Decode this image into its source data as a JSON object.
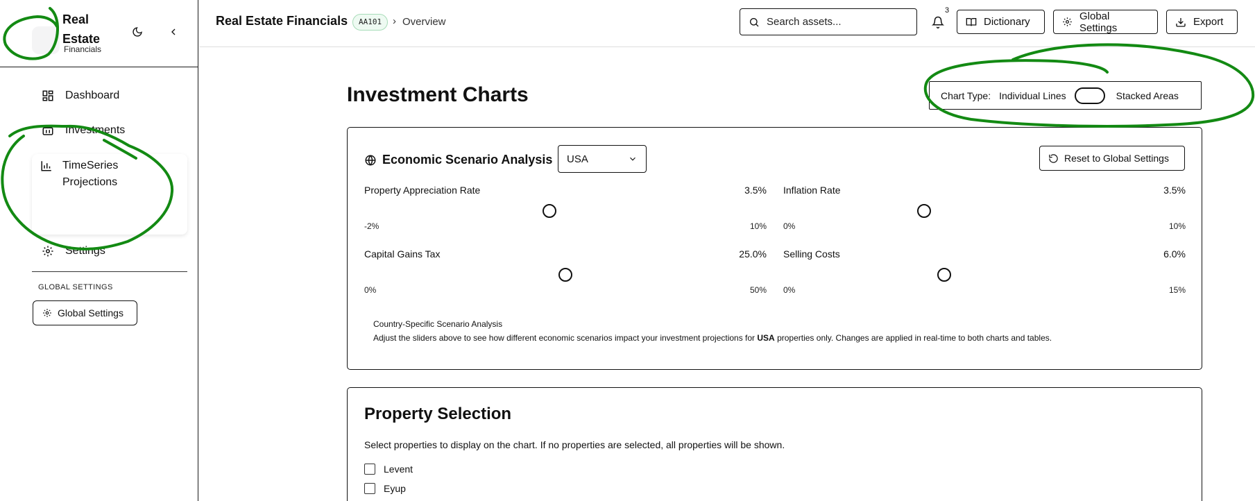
{
  "colors": {
    "accent": "#111111",
    "badge_bg": "#eefaf2",
    "badge_border": "#a7dcb8",
    "annotation": "#138a13"
  },
  "sidebar": {
    "brand": {
      "title": "Real Estate",
      "subtitle": "Financials"
    },
    "items": [
      {
        "label": "Dashboard",
        "icon": "dashboard-icon"
      },
      {
        "label": "Investments",
        "icon": "briefcase-icon"
      },
      {
        "label": "TimeSeries Projections",
        "icon": "bar-chart-icon"
      },
      {
        "label": "Settings",
        "icon": "gear-icon"
      }
    ],
    "section_label": "GLOBAL SETTINGS",
    "global_settings_button": "Global Settings"
  },
  "header": {
    "title": "Real Estate Financials",
    "code": "AA101",
    "breadcrumb_sep": "›",
    "breadcrumb": "Overview",
    "search_placeholder": "Search assets...",
    "notification_count": "3",
    "buttons": {
      "dictionary": "Dictionary",
      "global_settings": "Global Settings",
      "export": "Export"
    }
  },
  "main": {
    "title": "Investment Charts",
    "chart_type": {
      "label": "Chart Type:",
      "option_left": "Individual Lines",
      "option_right": "Stacked Areas",
      "stacked": false
    },
    "scenario": {
      "title": "Economic Scenario Analysis",
      "country": "USA",
      "reset_label": "Reset to Global Settings",
      "sliders": [
        {
          "name": "Property Appreciation Rate",
          "value_label": "3.5%",
          "min_label": "-2%",
          "max_label": "10%",
          "fraction": 0.46
        },
        {
          "name": "Inflation Rate",
          "value_label": "3.5%",
          "min_label": "0%",
          "max_label": "10%",
          "fraction": 0.35
        },
        {
          "name": "Capital Gains Tax",
          "value_label": "25.0%",
          "min_label": "0%",
          "max_label": "50%",
          "fraction": 0.5
        },
        {
          "name": "Selling Costs",
          "value_label": "6.0%",
          "min_label": "0%",
          "max_label": "15%",
          "fraction": 0.4
        }
      ],
      "note_title": "Country-Specific Scenario Analysis",
      "note_before": "Adjust the sliders above to see how different economic scenarios impact your investment projections for ",
      "note_country": "USA",
      "note_after": " properties only. Changes are applied in real-time to both charts and tables."
    },
    "property_selection": {
      "title": "Property Selection",
      "description": "Select properties to display on the chart. If no properties are selected, all properties will be shown.",
      "properties": [
        "Levent",
        "Eyup"
      ]
    }
  }
}
